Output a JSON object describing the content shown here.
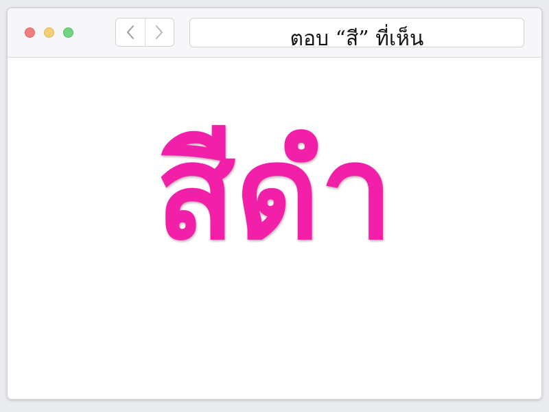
{
  "window": {
    "traffic_lights": [
      "close",
      "minimize",
      "maximize"
    ],
    "nav": {
      "back_icon": "chevron-left-icon",
      "forward_icon": "chevron-right-icon"
    },
    "address_bar": {
      "text": "ตอบ “สี” ที่เห็น"
    }
  },
  "content": {
    "word": "สีดำ",
    "word_color": "#f21fa9"
  },
  "colors": {
    "close": "#f07e7c",
    "minimize": "#f6cf74",
    "maximize": "#6ed67e"
  }
}
